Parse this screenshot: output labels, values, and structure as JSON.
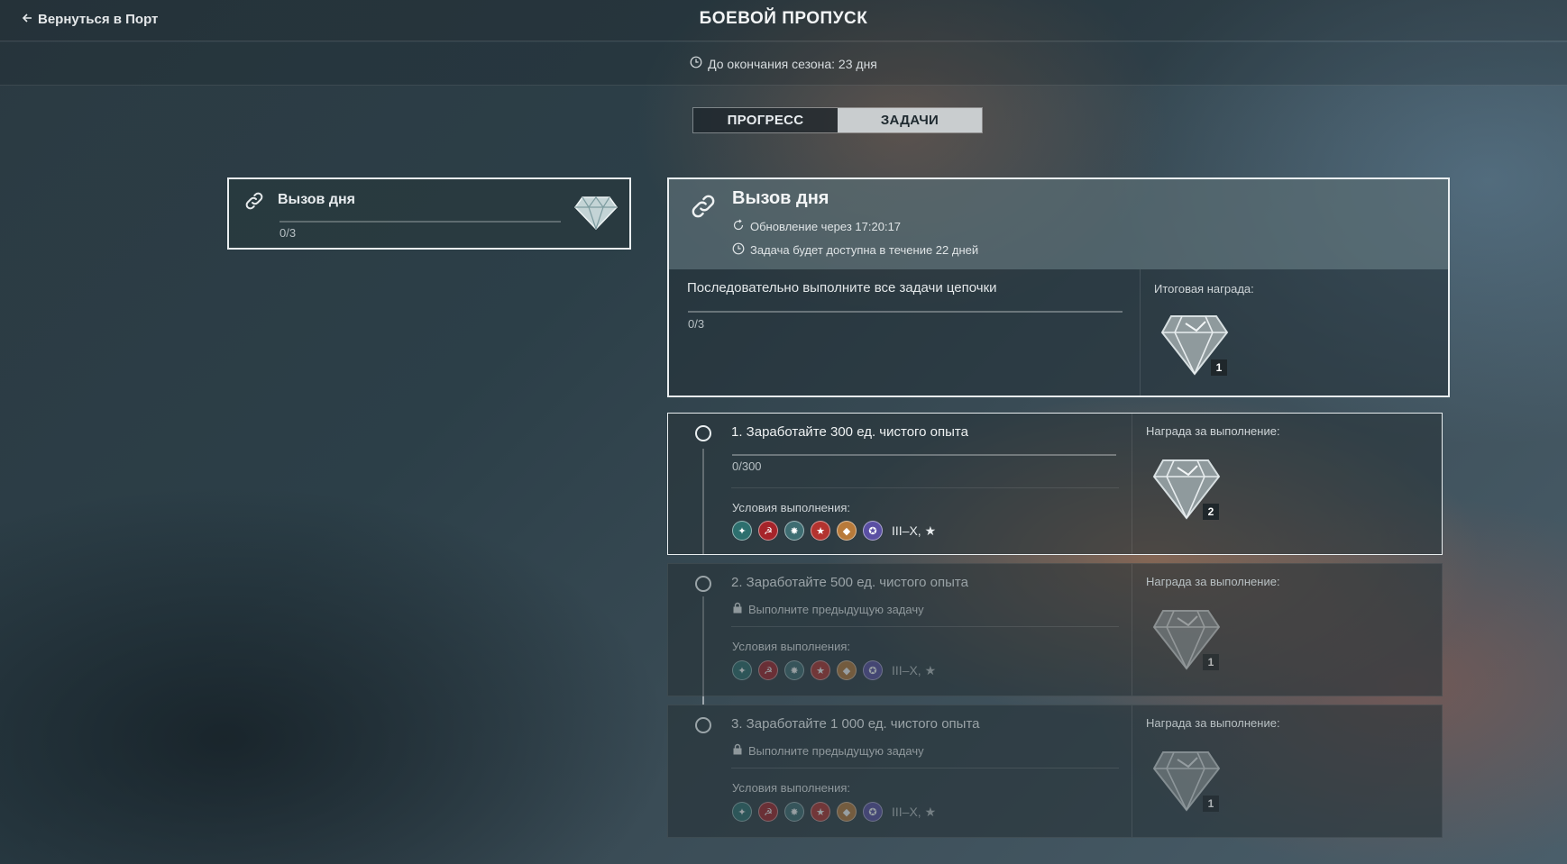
{
  "header": {
    "back_label": "Вернуться в Порт",
    "title": "БОЕВОЙ ПРОПУСК",
    "season_text": "До окончания сезона: 23 дня"
  },
  "tabs": [
    {
      "label": "ПРОГРЕСС",
      "active": false
    },
    {
      "label": "ЗАДАЧИ",
      "active": true
    }
  ],
  "challenge_card": {
    "title": "Вызов дня",
    "progress": "0/3",
    "progress_fraction": 0
  },
  "detail": {
    "title": "Вызов дня",
    "refresh_text": "Обновление через 17:20:17",
    "availability_text": "Задача будет доступна в течение 22 дней",
    "description": "Последовательно выполните все задачи цепочки",
    "progress": "0/3",
    "progress_fraction": 0,
    "reward_label": "Итоговая награда:",
    "reward_count": "1"
  },
  "tasks": [
    {
      "title": "1. Заработайте 300 ед. чистого опыта",
      "progress": "0/300",
      "progress_fraction": 0,
      "locked": false,
      "lock_text": "",
      "conditions_label": "Условия выполнения:",
      "tiers": "III–X, ★",
      "reward_label": "Награда за выполнение:",
      "reward_count": "2"
    },
    {
      "title": "2. Заработайте 500 ед. чистого опыта",
      "progress": "",
      "locked": true,
      "lock_text": "Выполните предыдущую задачу",
      "conditions_label": "Условия выполнения:",
      "tiers": "III–X, ★",
      "reward_label": "Награда за выполнение:",
      "reward_count": "1"
    },
    {
      "title": "3. Заработайте 1 000 ед. чистого опыта",
      "progress": "",
      "locked": true,
      "lock_text": "Выполните предыдущую задачу",
      "conditions_label": "Условия выполнения:",
      "tiers": "III–X, ★",
      "reward_label": "Награда за выполнение:",
      "reward_count": "1"
    }
  ],
  "nation_icons": [
    {
      "name": "nation-pan-asia-icon",
      "color": "#2d6f6e"
    },
    {
      "name": "nation-ussr-icon",
      "color": "#a6242a"
    },
    {
      "name": "nation-commonwealth-icon",
      "color": "#3e6d72"
    },
    {
      "name": "nation-usa-icon",
      "color": "#b3332f"
    },
    {
      "name": "nation-pan-america-icon",
      "color": "#b87a3a"
    },
    {
      "name": "nation-europe-icon",
      "color": "#5a4fa3"
    }
  ]
}
